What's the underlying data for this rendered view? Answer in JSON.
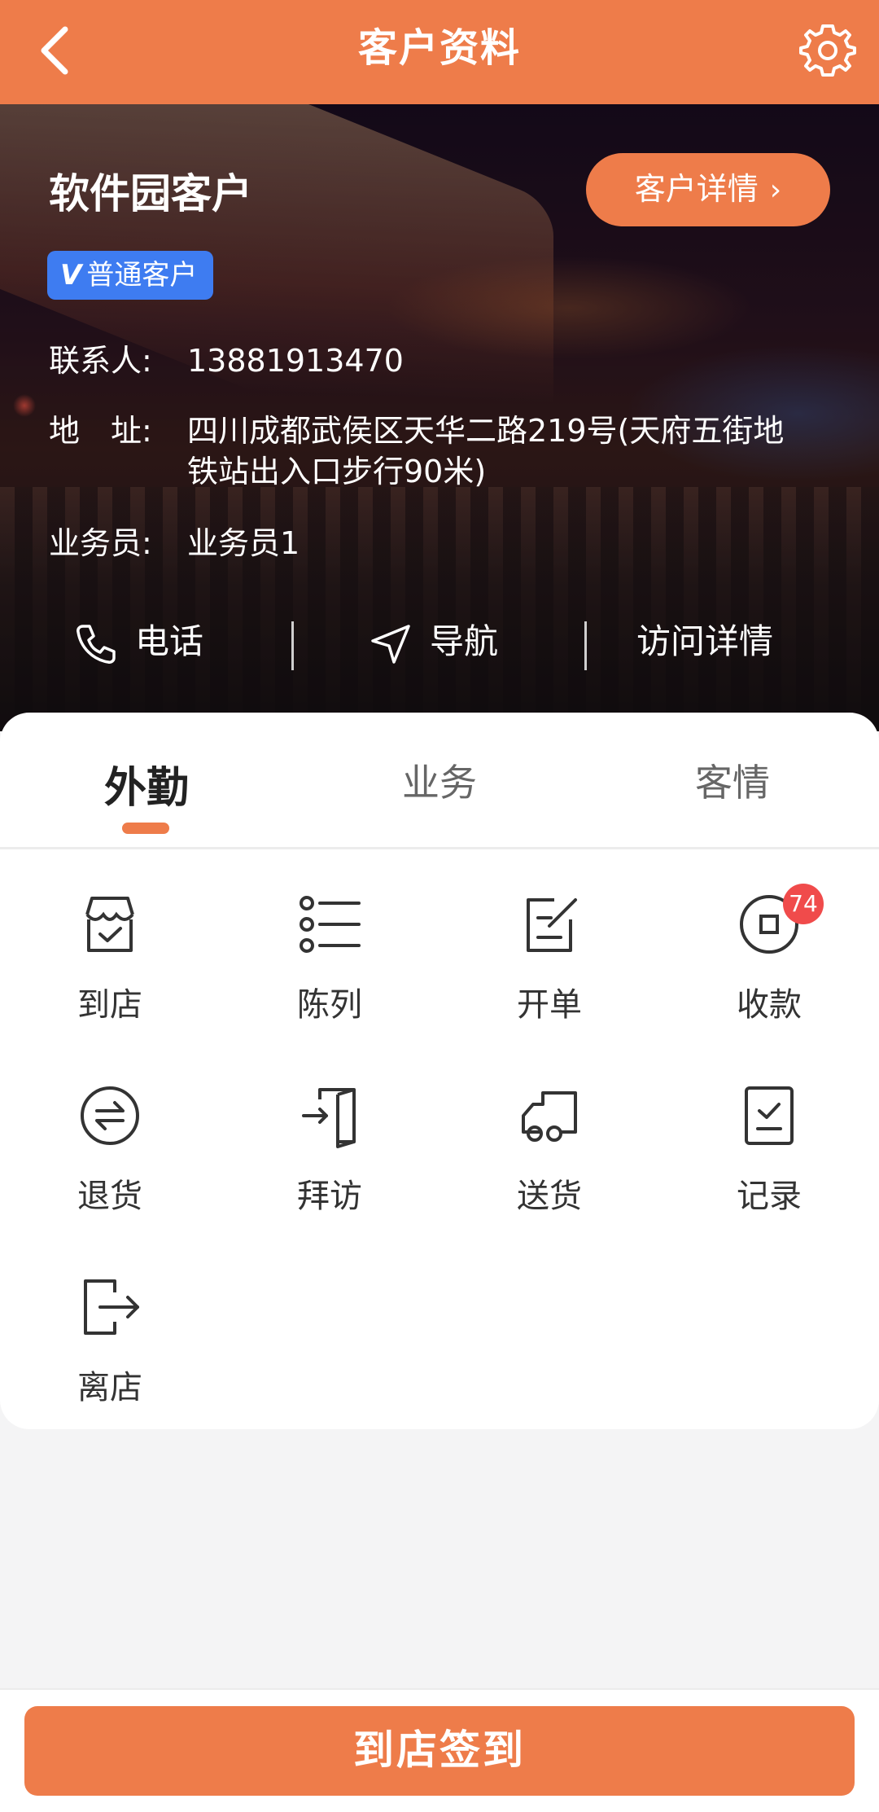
{
  "header": {
    "title": "客户资料",
    "back_icon": "chevron-left-icon",
    "settings_icon": "gear-icon"
  },
  "customer": {
    "name": "软件园客户",
    "detail_button": "客户详情",
    "badge_mark": "V",
    "badge": "普通客户",
    "contact_label": "联系人:",
    "contact_value": "13881913470",
    "address_label": "地　址:",
    "address_value": "四川成都武侯区天华二路219号(天府五街地铁站出入口步行90米)",
    "salesman_label": "业务员:",
    "salesman_value": "业务员1"
  },
  "actions": {
    "phone": "电话",
    "navigate": "导航",
    "visit_detail": "访问详情"
  },
  "tabs": [
    {
      "label": "外勤",
      "active": true
    },
    {
      "label": "业务"
    },
    {
      "label": "客情"
    }
  ],
  "grid": [
    {
      "label": "到店",
      "icon": "store-check-icon"
    },
    {
      "label": "陈列",
      "icon": "list-icon"
    },
    {
      "label": "开单",
      "icon": "edit-order-icon"
    },
    {
      "label": "收款",
      "icon": "payment-icon",
      "badge": "74"
    },
    {
      "label": "退货",
      "icon": "return-icon"
    },
    {
      "label": "拜访",
      "icon": "visit-door-icon"
    },
    {
      "label": "送货",
      "icon": "truck-icon"
    },
    {
      "label": "记录",
      "icon": "record-icon"
    },
    {
      "label": "离店",
      "icon": "exit-icon"
    }
  ],
  "footer": {
    "checkin_button": "到店签到"
  },
  "colors": {
    "accent": "#ee7c4a",
    "badge_blue": "#3e7cf1",
    "alert_red": "#f04b4b"
  }
}
